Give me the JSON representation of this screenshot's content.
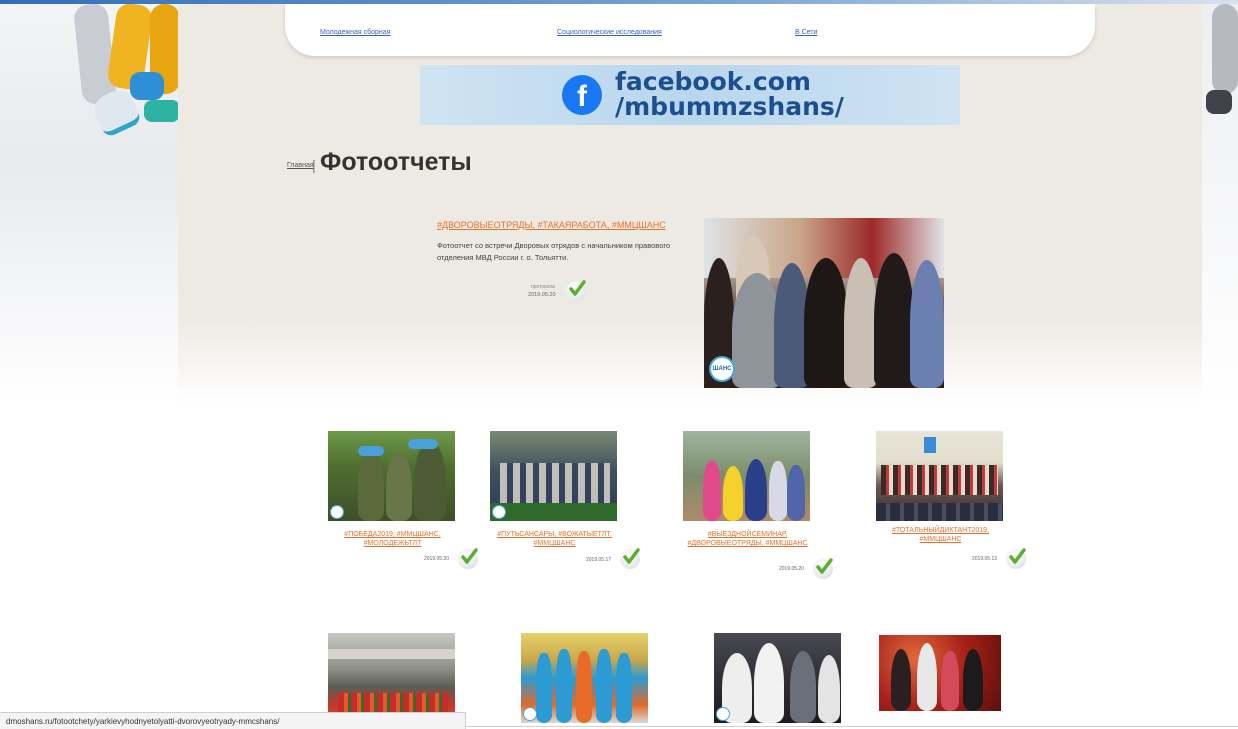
{
  "nav": {
    "links": [
      "Молодежная сборная",
      "Социологические исследования",
      "В Сети"
    ]
  },
  "banner": {
    "icon": "facebook-icon",
    "line1": "facebook.com",
    "line2": "/mbummzshans/",
    "color": "#1877f2"
  },
  "breadcrumb": {
    "home": "Главная",
    "separator": "|"
  },
  "page_title": "Фотоотчеты",
  "featured": {
    "title": "#ДВОРОВЫЕОТРЯДЫ, #ТАКАЯРАБОТА, #ММЦШАНС",
    "description": "Фотоотчет со встречи Дворовых отрядов с начальником правового отделения МВД России г. о. Тольятти.",
    "date_label": "протокола",
    "date": "2019.05.20",
    "logo": "ШАНС"
  },
  "cards": [
    {
      "title": "#ПОБЕДА2019, #ММЦШАНС, #МОЛОДЕЖЬТЛТ",
      "date": "2019.05.20"
    },
    {
      "title": "#ПУТЬСАНСАРЫ, #ВОЖАТЫЕТЛТ, #ММЦШАНС",
      "date": "2019.05.17"
    },
    {
      "title": "#ВЫЕЗДНОЙСЕМИНАР, #ДВОРОВЫЕОТРЯДЫ, #ММЦШАНС",
      "date": "2019.05.20"
    },
    {
      "title": "#ТОТАЛЬНЫЙДИКТАНТ2019, #ММЦШАНС",
      "date": "2019.05.13"
    }
  ],
  "status_bar": {
    "url": "dmoshans.ru/fotootchety/yarkievyhodnyetolyatti-dvorovyeotryady-mmcshans/"
  },
  "colors": {
    "accent": "#e8712a",
    "link": "#3a64c2",
    "panel": "#ede9e3"
  }
}
